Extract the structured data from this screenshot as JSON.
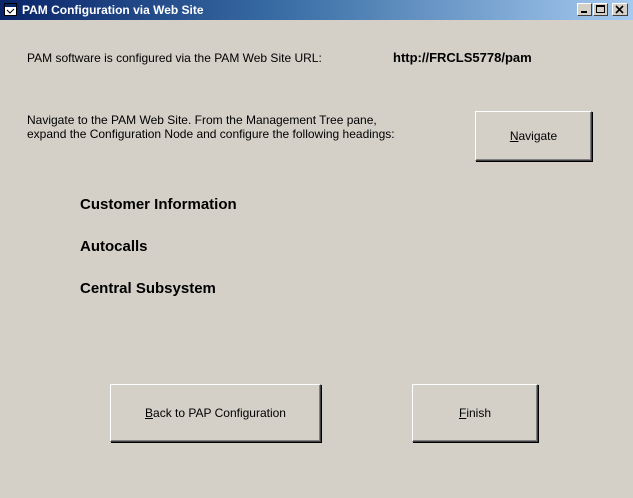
{
  "window": {
    "title": "PAM Configuration via Web Site",
    "icon": "window-app-icon"
  },
  "intro": {
    "label": "PAM software is configured via the PAM Web Site URL:",
    "url": "http://FRCLS5778/pam"
  },
  "instructions": "Navigate to the PAM Web Site. From the Management Tree pane, expand the Configuration Node and configure the following headings:",
  "headings": [
    "Customer Information",
    "Autocalls",
    "Central Subsystem"
  ],
  "buttons": {
    "navigate": {
      "accel": "N",
      "rest": "avigate"
    },
    "back": {
      "accel": "B",
      "rest": "ack to PAP Configuration"
    },
    "finish": {
      "accel": "F",
      "rest": "inish"
    }
  }
}
